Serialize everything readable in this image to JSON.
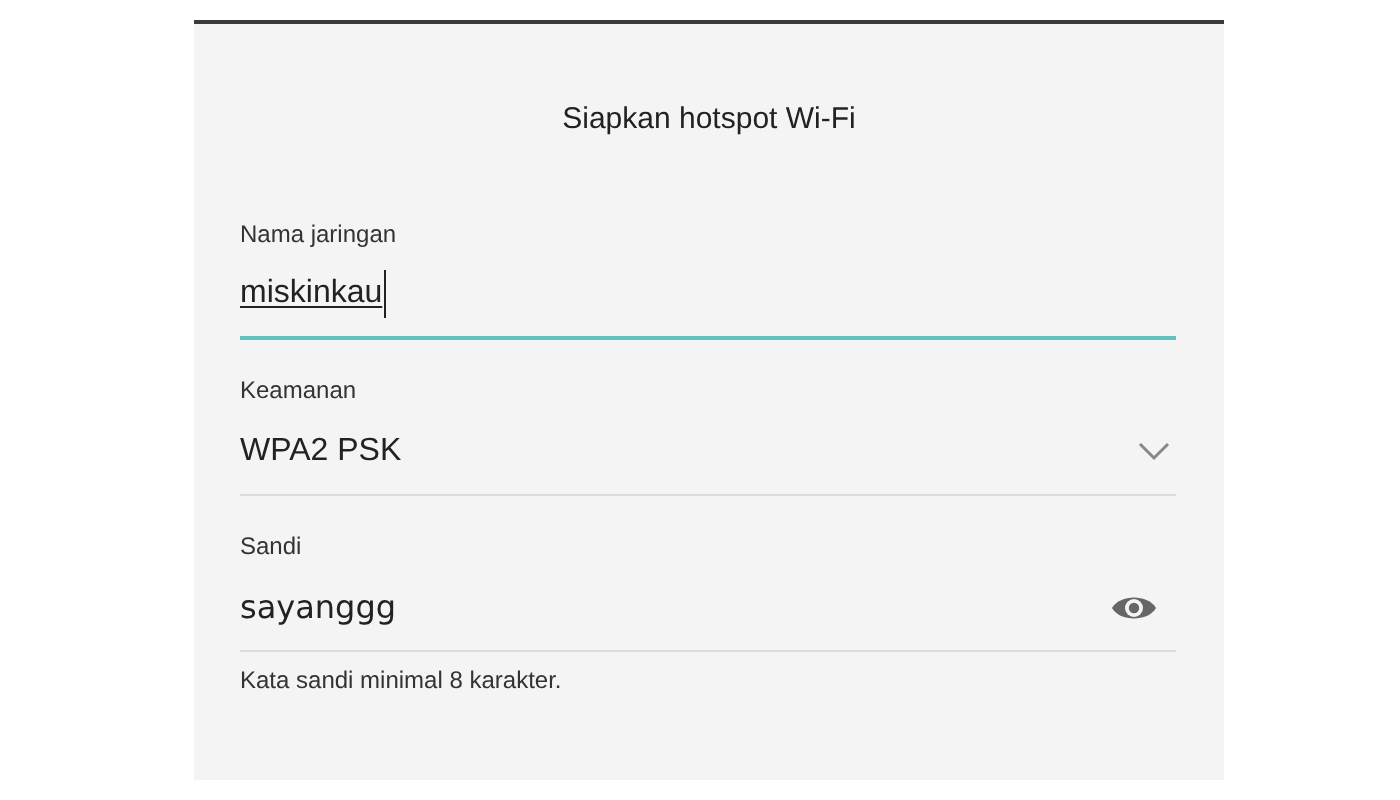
{
  "dialog": {
    "title": "Siapkan hotspot Wi-Fi"
  },
  "fields": [
    {
      "kind": "text",
      "label": "Nama jaringan",
      "value": "miskinkau",
      "focused": true
    },
    {
      "kind": "dropdown",
      "label": "Keamanan",
      "value": "WPA2 PSK",
      "focused": false
    },
    {
      "kind": "password",
      "label": "Sandi",
      "value": "sayanggg",
      "focused": false,
      "hint": "Kata sandi minimal 8 karakter."
    }
  ]
}
